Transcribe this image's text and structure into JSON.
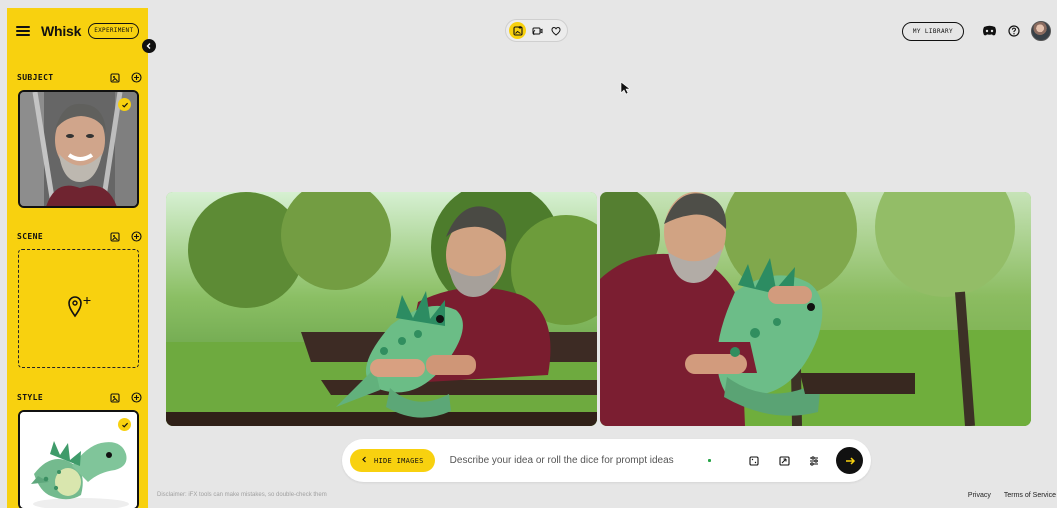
{
  "colors": {
    "accent": "#f8d10f",
    "background": "#e6e6e6",
    "dark": "#111111",
    "white": "#ffffff"
  },
  "sidebar": {
    "app_name": "Whisk",
    "badge": "EXPERIMENT",
    "menu_icon": "hamburger-icon",
    "collapse_icon": "chevron-left-icon",
    "sections": {
      "subject": {
        "title": "SUBJECT",
        "image_icon": "image-icon",
        "add_icon": "plus-circle-icon",
        "selected": true,
        "check_icon": "check-icon"
      },
      "scene": {
        "title": "SCENE",
        "image_icon": "image-icon",
        "add_icon": "plus-circle-icon",
        "empty_icon": "location-pin-plus-icon"
      },
      "style": {
        "title": "STYLE",
        "image_icon": "image-icon",
        "add_icon": "plus-circle-icon",
        "selected": true,
        "check_icon": "check-icon"
      }
    }
  },
  "topbar": {
    "modes": [
      {
        "icon": "image-plus-icon",
        "active": true
      },
      {
        "icon": "animate-icon",
        "active": false
      },
      {
        "icon": "heart-icon",
        "active": false
      }
    ],
    "library_label": "MY LIBRARY",
    "discord_icon": "discord-icon",
    "help_icon": "help-circle-icon",
    "avatar_icon": "user-avatar"
  },
  "pointer": {
    "icon": "mouse-cursor-icon"
  },
  "results": [
    {
      "name": "generated-image-1"
    },
    {
      "name": "generated-image-2"
    }
  ],
  "prompt": {
    "hide_images_label": "HIDE IMAGES",
    "hide_icon": "chevron-left-icon",
    "placeholder": "Describe your idea or roll the dice for prompt ideas",
    "value": "",
    "tools": [
      {
        "icon": "dice-icon"
      },
      {
        "icon": "aspect-ratio-icon"
      },
      {
        "icon": "settings-sliders-icon"
      }
    ],
    "submit_icon": "arrow-right-icon"
  },
  "footer": {
    "disclaimer": "Disclaimer: iFX tools can make mistakes, so double-check them",
    "privacy": "Privacy",
    "terms": "Terms of Service"
  }
}
